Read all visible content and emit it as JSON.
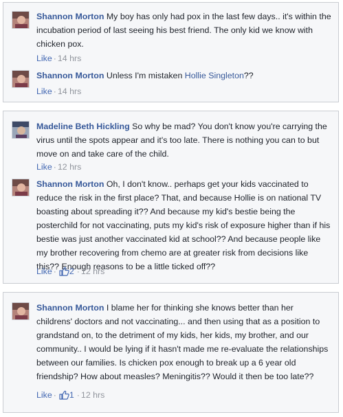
{
  "threads": [
    {
      "comments": [
        {
          "author": "Shannon Morton",
          "body": " My boy has only had pox in the last few days.. it's within the incubation period of last seeing his best friend. The only kid we know with chicken pox.",
          "like_label": "Like",
          "time": "14 hrs"
        },
        {
          "author": "Shannon Morton",
          "body": " Unless I'm mistaken ",
          "mention": "Hollie Singleton",
          "body_after": "??",
          "like_label": "Like",
          "time": "14 hrs"
        }
      ]
    },
    {
      "comments": [
        {
          "author": "Madeline Beth Hickling",
          "body": " So why be mad? You don't know you're carrying the virus until the spots appear and it's too late. There is nothing you can to but move on and take care of the child.",
          "like_label": "Like",
          "time": "12 hrs"
        },
        {
          "author": "Shannon Morton",
          "body": " Oh, I don't know.. perhaps get your kids vaccinated to reduce the risk in the first place? That, and because Hollie is on national TV boasting about spreading it?? And because my kid's bestie being the posterchild for not vaccinating, puts my kid's risk of exposure higher than if his bestie was just another vaccinated kid at school?? And because people like my brother recovering from chemo are at greater risk from decisions like this?? Enough reasons to be a little ticked off??",
          "like_label": "Like",
          "likes": "2",
          "time": "12 hrs"
        }
      ]
    },
    {
      "comments": [
        {
          "author": "Shannon Morton",
          "body": " I blame her for thinking she knows better than her childrens' doctors and not vaccinating... and then using that as a position to grandstand on, to the detriment of my kids, her kids, my brother, and our community.. I would be lying if it hasn't made me re-evaluate the relationships between our families. Is chicken pox enough to break up a 6 year old friendship? How about measles? Meningitis?? Would it then be too late??",
          "like_label": "Like",
          "likes": "1",
          "time": "12 hrs"
        }
      ]
    }
  ],
  "colors": {
    "author": "#365899",
    "link": "#4267b2",
    "meta": "#90949c",
    "panel_bg": "#f6f7f9",
    "panel_border": "#c9ccd1"
  },
  "icons": {
    "avatar_shannon": "avatar-photo",
    "avatar_madeline": "avatar-photo",
    "like_thumb": "thumbs-up-icon"
  }
}
